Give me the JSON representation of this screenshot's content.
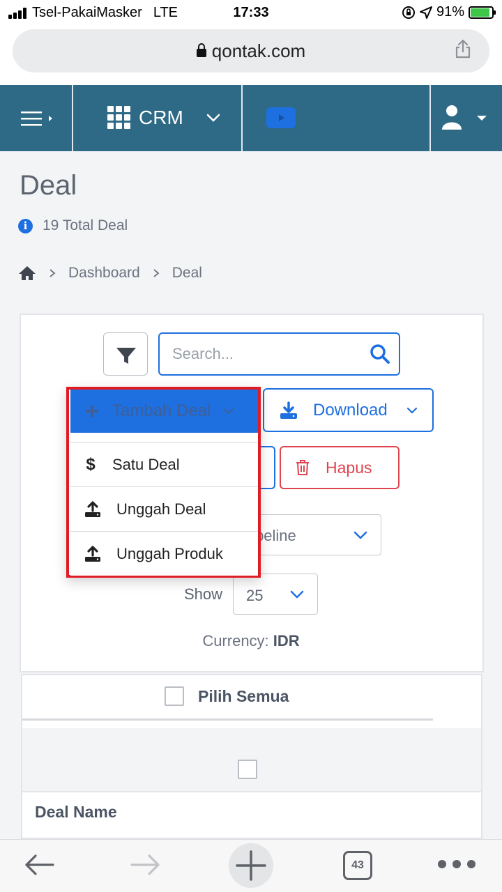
{
  "status_bar": {
    "carrier": "Tsel-PakaiMasker",
    "network": "LTE",
    "time": "17:33",
    "battery": "91%"
  },
  "browser": {
    "url": "qontak.com",
    "tabs_count": "43"
  },
  "app_header": {
    "module": "CRM",
    "brand_color": "#2e6a86"
  },
  "page": {
    "title": "Deal",
    "total_info": "19 Total Deal",
    "breadcrumb": [
      "Dashboard",
      "Deal"
    ]
  },
  "toolbar": {
    "search_placeholder": "Search...",
    "add_label": "Tambah Deal",
    "download_label": "Download",
    "delete_label": "Hapus",
    "pipeline_label": "peline",
    "show_label": "Show",
    "show_value": "25",
    "currency_label": "Currency:",
    "currency_value": "IDR"
  },
  "add_menu": {
    "items": [
      {
        "label": "Satu Deal",
        "icon": "dollar-icon"
      },
      {
        "label": "Unggah Deal",
        "icon": "upload-icon"
      },
      {
        "label": "Unggah Produk",
        "icon": "upload-icon"
      }
    ]
  },
  "table": {
    "select_all_label": "Pilih Semua",
    "column_deal_name": "Deal Name"
  },
  "colors": {
    "primary": "#1e6fe0",
    "danger": "#e0454f",
    "highlight": "#e01b24"
  }
}
